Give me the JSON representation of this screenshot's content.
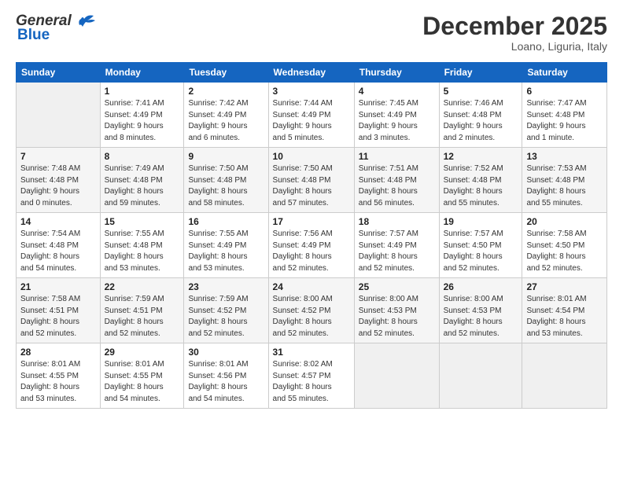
{
  "header": {
    "logo_general": "General",
    "logo_blue": "Blue",
    "month": "December 2025",
    "location": "Loano, Liguria, Italy"
  },
  "days_of_week": [
    "Sunday",
    "Monday",
    "Tuesday",
    "Wednesday",
    "Thursday",
    "Friday",
    "Saturday"
  ],
  "weeks": [
    [
      {
        "day": "",
        "info": ""
      },
      {
        "day": "1",
        "info": "Sunrise: 7:41 AM\nSunset: 4:49 PM\nDaylight: 9 hours\nand 8 minutes."
      },
      {
        "day": "2",
        "info": "Sunrise: 7:42 AM\nSunset: 4:49 PM\nDaylight: 9 hours\nand 6 minutes."
      },
      {
        "day": "3",
        "info": "Sunrise: 7:44 AM\nSunset: 4:49 PM\nDaylight: 9 hours\nand 5 minutes."
      },
      {
        "day": "4",
        "info": "Sunrise: 7:45 AM\nSunset: 4:49 PM\nDaylight: 9 hours\nand 3 minutes."
      },
      {
        "day": "5",
        "info": "Sunrise: 7:46 AM\nSunset: 4:48 PM\nDaylight: 9 hours\nand 2 minutes."
      },
      {
        "day": "6",
        "info": "Sunrise: 7:47 AM\nSunset: 4:48 PM\nDaylight: 9 hours\nand 1 minute."
      }
    ],
    [
      {
        "day": "7",
        "info": "Sunrise: 7:48 AM\nSunset: 4:48 PM\nDaylight: 9 hours\nand 0 minutes."
      },
      {
        "day": "8",
        "info": "Sunrise: 7:49 AM\nSunset: 4:48 PM\nDaylight: 8 hours\nand 59 minutes."
      },
      {
        "day": "9",
        "info": "Sunrise: 7:50 AM\nSunset: 4:48 PM\nDaylight: 8 hours\nand 58 minutes."
      },
      {
        "day": "10",
        "info": "Sunrise: 7:50 AM\nSunset: 4:48 PM\nDaylight: 8 hours\nand 57 minutes."
      },
      {
        "day": "11",
        "info": "Sunrise: 7:51 AM\nSunset: 4:48 PM\nDaylight: 8 hours\nand 56 minutes."
      },
      {
        "day": "12",
        "info": "Sunrise: 7:52 AM\nSunset: 4:48 PM\nDaylight: 8 hours\nand 55 minutes."
      },
      {
        "day": "13",
        "info": "Sunrise: 7:53 AM\nSunset: 4:48 PM\nDaylight: 8 hours\nand 55 minutes."
      }
    ],
    [
      {
        "day": "14",
        "info": "Sunrise: 7:54 AM\nSunset: 4:48 PM\nDaylight: 8 hours\nand 54 minutes."
      },
      {
        "day": "15",
        "info": "Sunrise: 7:55 AM\nSunset: 4:48 PM\nDaylight: 8 hours\nand 53 minutes."
      },
      {
        "day": "16",
        "info": "Sunrise: 7:55 AM\nSunset: 4:49 PM\nDaylight: 8 hours\nand 53 minutes."
      },
      {
        "day": "17",
        "info": "Sunrise: 7:56 AM\nSunset: 4:49 PM\nDaylight: 8 hours\nand 52 minutes."
      },
      {
        "day": "18",
        "info": "Sunrise: 7:57 AM\nSunset: 4:49 PM\nDaylight: 8 hours\nand 52 minutes."
      },
      {
        "day": "19",
        "info": "Sunrise: 7:57 AM\nSunset: 4:50 PM\nDaylight: 8 hours\nand 52 minutes."
      },
      {
        "day": "20",
        "info": "Sunrise: 7:58 AM\nSunset: 4:50 PM\nDaylight: 8 hours\nand 52 minutes."
      }
    ],
    [
      {
        "day": "21",
        "info": "Sunrise: 7:58 AM\nSunset: 4:51 PM\nDaylight: 8 hours\nand 52 minutes."
      },
      {
        "day": "22",
        "info": "Sunrise: 7:59 AM\nSunset: 4:51 PM\nDaylight: 8 hours\nand 52 minutes."
      },
      {
        "day": "23",
        "info": "Sunrise: 7:59 AM\nSunset: 4:52 PM\nDaylight: 8 hours\nand 52 minutes."
      },
      {
        "day": "24",
        "info": "Sunrise: 8:00 AM\nSunset: 4:52 PM\nDaylight: 8 hours\nand 52 minutes."
      },
      {
        "day": "25",
        "info": "Sunrise: 8:00 AM\nSunset: 4:53 PM\nDaylight: 8 hours\nand 52 minutes."
      },
      {
        "day": "26",
        "info": "Sunrise: 8:00 AM\nSunset: 4:53 PM\nDaylight: 8 hours\nand 52 minutes."
      },
      {
        "day": "27",
        "info": "Sunrise: 8:01 AM\nSunset: 4:54 PM\nDaylight: 8 hours\nand 53 minutes."
      }
    ],
    [
      {
        "day": "28",
        "info": "Sunrise: 8:01 AM\nSunset: 4:55 PM\nDaylight: 8 hours\nand 53 minutes."
      },
      {
        "day": "29",
        "info": "Sunrise: 8:01 AM\nSunset: 4:55 PM\nDaylight: 8 hours\nand 54 minutes."
      },
      {
        "day": "30",
        "info": "Sunrise: 8:01 AM\nSunset: 4:56 PM\nDaylight: 8 hours\nand 54 minutes."
      },
      {
        "day": "31",
        "info": "Sunrise: 8:02 AM\nSunset: 4:57 PM\nDaylight: 8 hours\nand 55 minutes."
      },
      {
        "day": "",
        "info": ""
      },
      {
        "day": "",
        "info": ""
      },
      {
        "day": "",
        "info": ""
      }
    ]
  ]
}
